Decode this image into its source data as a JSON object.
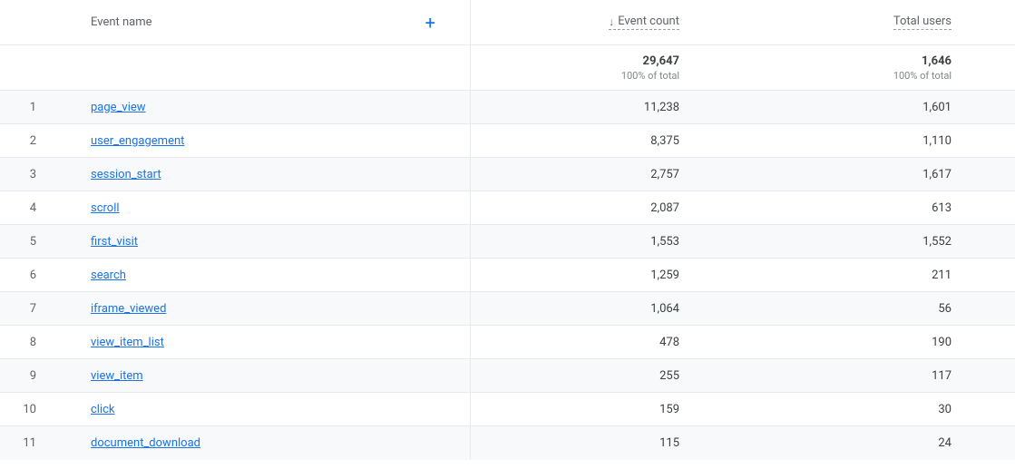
{
  "header": {
    "name_label": "Event name",
    "event_count_label": "Event count",
    "total_users_label": "Total users",
    "plus_label": "+"
  },
  "totals": {
    "event_count": "29,647",
    "event_count_pct": "100% of total",
    "total_users": "1,646",
    "total_users_pct": "100% of total"
  },
  "rows": [
    {
      "idx": "1",
      "name": "page_view",
      "event_count": "11,238",
      "total_users": "1,601"
    },
    {
      "idx": "2",
      "name": "user_engagement",
      "event_count": "8,375",
      "total_users": "1,110"
    },
    {
      "idx": "3",
      "name": "session_start",
      "event_count": "2,757",
      "total_users": "1,617"
    },
    {
      "idx": "4",
      "name": "scroll",
      "event_count": "2,087",
      "total_users": "613"
    },
    {
      "idx": "5",
      "name": "first_visit",
      "event_count": "1,553",
      "total_users": "1,552"
    },
    {
      "idx": "6",
      "name": "search",
      "event_count": "1,259",
      "total_users": "211"
    },
    {
      "idx": "7",
      "name": "iframe_viewed",
      "event_count": "1,064",
      "total_users": "56"
    },
    {
      "idx": "8",
      "name": "view_item_list",
      "event_count": "478",
      "total_users": "190"
    },
    {
      "idx": "9",
      "name": "view_item",
      "event_count": "255",
      "total_users": "117"
    },
    {
      "idx": "10",
      "name": "click",
      "event_count": "159",
      "total_users": "30"
    },
    {
      "idx": "11",
      "name": "document_download",
      "event_count": "115",
      "total_users": "24"
    }
  ]
}
